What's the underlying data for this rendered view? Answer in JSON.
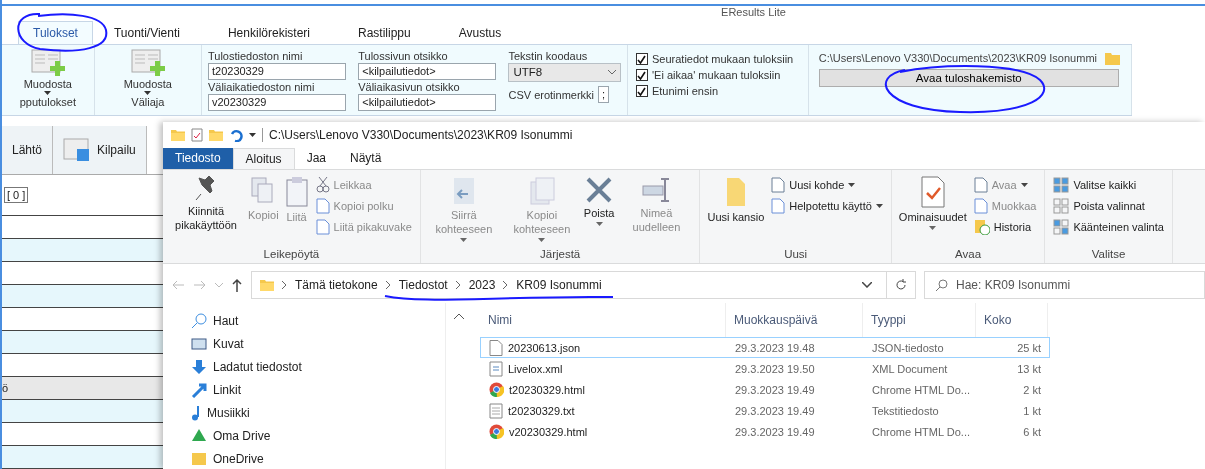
{
  "app": {
    "title": "EResults Lite",
    "tabs": [
      {
        "label": "Tulokset",
        "selected": true
      },
      {
        "label": "Tuonti/Vienti",
        "selected": false
      },
      {
        "label": "Henkilörekisteri",
        "selected": false
      },
      {
        "label": "Rastilippu",
        "selected": false
      },
      {
        "label": "Avustus",
        "selected": false
      }
    ],
    "make_buttons": [
      {
        "label": "Muodosta",
        "group": "pputulokset"
      },
      {
        "label": "Muodosta",
        "group": "Väliaja"
      }
    ],
    "fields": [
      {
        "label": "Tulostiedoston nimi",
        "value": "t20230329"
      },
      {
        "label": "Tulossivun otsikko",
        "value": "<kilpailutiedot>"
      },
      {
        "label": "Väliaikatiedoston nimi",
        "value": "v20230329"
      },
      {
        "label": "Väliaikasivun otsikko",
        "value": "<kilpailutiedot>"
      }
    ],
    "encoding": {
      "label": "Tekstin koodaus",
      "value": "UTF8"
    },
    "csv": {
      "label": "CSV erotinmerkki",
      "value": ";"
    },
    "checkboxes": [
      {
        "label": "Seuratiedot mukaan tuloksiin",
        "checked": true
      },
      {
        "label": "'Ei aikaa' mukaan tuloksiin",
        "checked": true
      },
      {
        "label": "Etunimi ensin",
        "checked": true
      }
    ],
    "folder_path": "C:\\Users\\Lenovo V330\\Documents\\2023\\KR09 Isonummi",
    "open_button": "Avaa tuloshakemisto",
    "side_tabs": [
      {
        "label": "Lähtö"
      },
      {
        "label": "Kilpailu"
      }
    ],
    "counter": "[ 0 ]",
    "row_text": "ö"
  },
  "explorer": {
    "title_path": "C:\\Users\\Lenovo V330\\Documents\\2023\\KR09 Isonummi",
    "tabs": [
      {
        "label": "Tiedosto",
        "kind": "file",
        "selected": false
      },
      {
        "label": "Aloitus",
        "kind": "tab",
        "selected": true
      },
      {
        "label": "Jaa",
        "kind": "tab",
        "selected": false
      },
      {
        "label": "Näytä",
        "kind": "tab",
        "selected": false
      }
    ],
    "groups": [
      {
        "label": "Leikepöytä",
        "large": [
          {
            "label": "Kiinnitä pikakäyttöön",
            "disabled": false,
            "dropdown": false
          },
          {
            "label": "Kopioi",
            "disabled": true,
            "dropdown": false
          },
          {
            "label": "Liitä",
            "disabled": true,
            "dropdown": false
          }
        ],
        "small": [
          {
            "label": "Leikkaa",
            "disabled": true,
            "dropdown": false
          },
          {
            "label": "Kopioi polku",
            "disabled": true,
            "dropdown": false
          },
          {
            "label": "Liitä pikakuvake",
            "disabled": true,
            "dropdown": false
          }
        ]
      },
      {
        "label": "Järjestä",
        "large": [
          {
            "label": "Siirrä kohteeseen",
            "disabled": true,
            "dropdown": true
          },
          {
            "label": "Kopioi kohteeseen",
            "disabled": true,
            "dropdown": true
          },
          {
            "label": "Poista",
            "disabled": false,
            "dropdown": true
          },
          {
            "label": "Nimeä uudelleen",
            "disabled": true,
            "dropdown": false
          }
        ]
      },
      {
        "label": "Uusi",
        "large": [
          {
            "label": "Uusi kansio",
            "disabled": false,
            "dropdown": false
          }
        ],
        "small": [
          {
            "label": "Uusi kohde",
            "disabled": false,
            "dropdown": true
          },
          {
            "label": "Helpotettu käyttö",
            "disabled": false,
            "dropdown": true
          }
        ]
      },
      {
        "label": "Avaa",
        "large": [
          {
            "label": "Ominaisuudet",
            "disabled": false,
            "dropdown": true
          }
        ],
        "small": [
          {
            "label": "Avaa",
            "disabled": true,
            "dropdown": true
          },
          {
            "label": "Muokkaa",
            "disabled": true,
            "dropdown": false
          },
          {
            "label": "Historia",
            "disabled": false,
            "dropdown": false
          }
        ]
      },
      {
        "label": "Valitse",
        "small": [
          {
            "label": "Valitse kaikki",
            "disabled": false,
            "dropdown": false
          },
          {
            "label": "Poista valinnat",
            "disabled": false,
            "dropdown": false
          },
          {
            "label": "Käänteinen valinta",
            "disabled": false,
            "dropdown": false
          }
        ]
      }
    ],
    "breadcrumbs": [
      "Tämä tietokone",
      "Tiedostot",
      "2023",
      "KR09 Isonummi"
    ],
    "search": {
      "placeholder": "Hae: KR09 Isonummi"
    },
    "nav": [
      "Haut",
      "Kuvat",
      "Ladatut tiedostot",
      "Linkit",
      "Musiikki",
      "Oma Drive",
      "OneDrive"
    ],
    "columns": [
      "Nimi",
      "Muokkauspäivä",
      "Tyyppi",
      "Koko"
    ],
    "files": [
      {
        "name": "20230613.json",
        "date": "29.3.2023 19.48",
        "type": "JSON-tiedosto",
        "size": "25 kt",
        "kind": "doc",
        "selected": true
      },
      {
        "name": "Livelox.xml",
        "date": "29.3.2023 19.50",
        "type": "XML Document",
        "size": "13 kt",
        "kind": "xml",
        "selected": false
      },
      {
        "name": "t20230329.html",
        "date": "29.3.2023 19.49",
        "type": "Chrome HTML Do...",
        "size": "2 kt",
        "kind": "web",
        "selected": false
      },
      {
        "name": "t20230329.txt",
        "date": "29.3.2023 19.49",
        "type": "Tekstitiedosto",
        "size": "1 kt",
        "kind": "text",
        "selected": false
      },
      {
        "name": "v20230329.html",
        "date": "29.3.2023 19.49",
        "type": "Chrome HTML Do...",
        "size": "6 kt",
        "kind": "web",
        "selected": false
      }
    ]
  }
}
